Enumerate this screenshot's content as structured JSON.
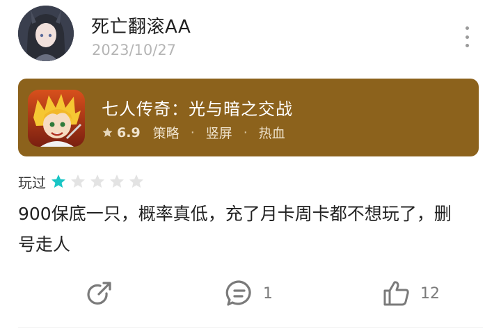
{
  "post": {
    "user_name": "死亡翻滚AA",
    "date": "2023/10/27"
  },
  "game": {
    "title": "七人传奇：光与暗之交战",
    "score": "6.9",
    "tags": [
      "策略",
      "竖屏",
      "热血"
    ],
    "separator": "·",
    "card_color": "#8c621c"
  },
  "rating": {
    "label": "玩过",
    "value": 1,
    "max": 5,
    "filled_color": "#19c5c5",
    "empty_color": "#e3e3e3"
  },
  "review": {
    "text": "900保底一只，概率真低，充了月卡周卡都不想玩了，删号走人"
  },
  "actions": {
    "comment_count": "1",
    "like_count": "12"
  }
}
